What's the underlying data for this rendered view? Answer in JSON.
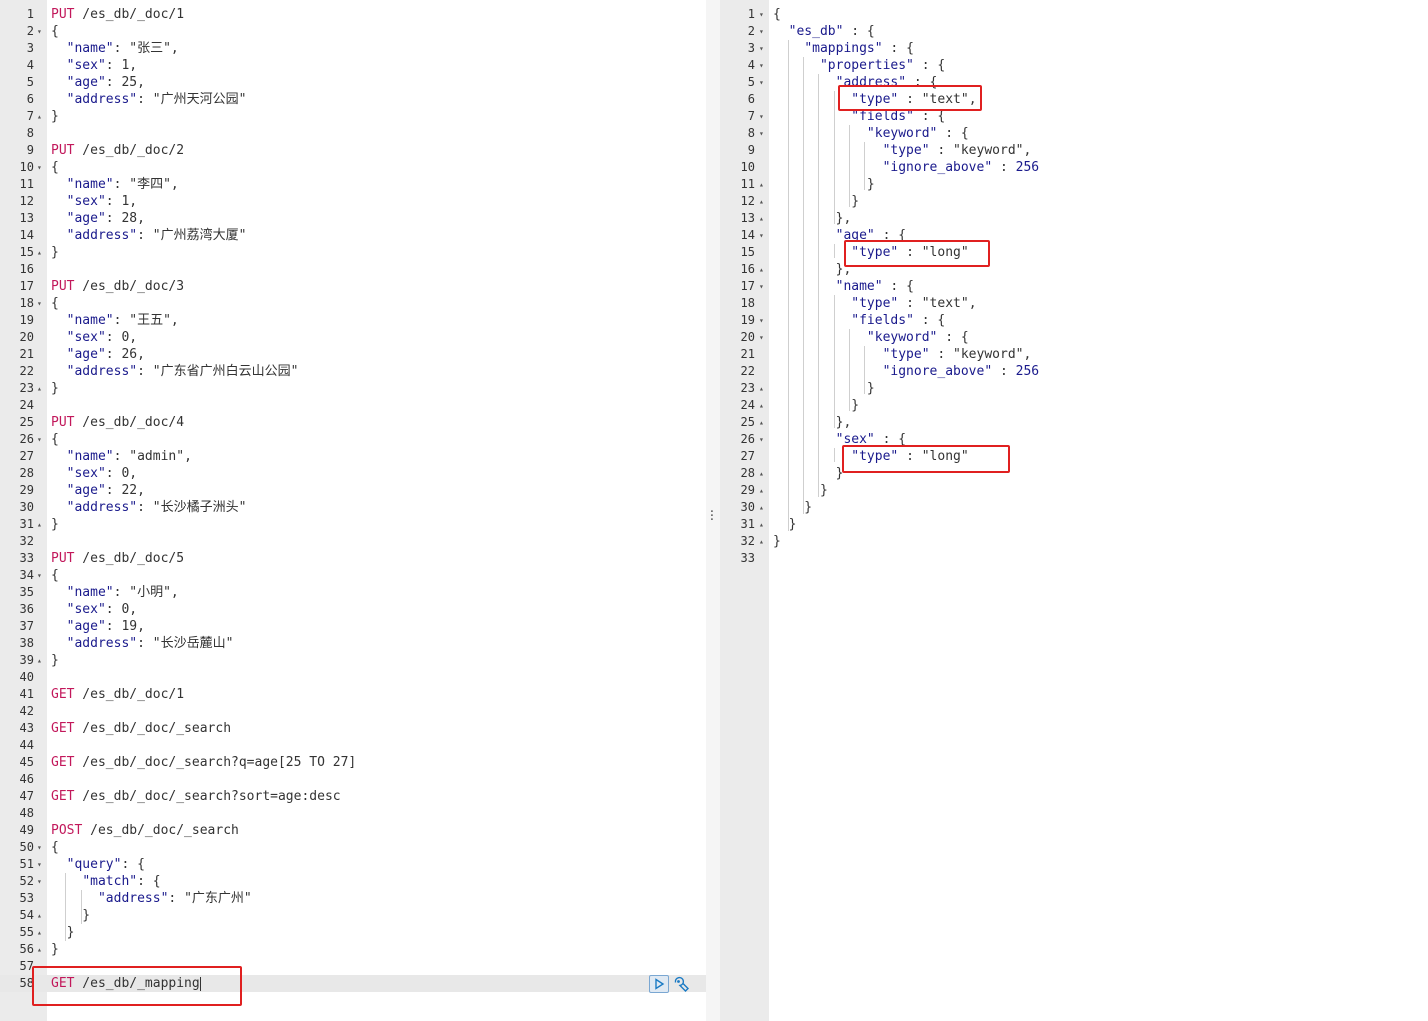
{
  "request_editor": {
    "lines": [
      {
        "n": "1",
        "fold": "",
        "parts": [
          [
            "m",
            "PUT"
          ],
          [
            "c",
            " /es_db/_doc/1"
          ]
        ]
      },
      {
        "n": "2",
        "fold": "▾",
        "parts": [
          [
            "c",
            "{"
          ]
        ]
      },
      {
        "n": "3",
        "fold": "",
        "parts": [
          [
            "c",
            "  "
          ],
          [
            "k",
            "\"name\""
          ],
          [
            "c",
            ": \"张三\","
          ]
        ]
      },
      {
        "n": "4",
        "fold": "",
        "parts": [
          [
            "c",
            "  "
          ],
          [
            "k",
            "\"sex\""
          ],
          [
            "c",
            ": 1,"
          ]
        ]
      },
      {
        "n": "5",
        "fold": "",
        "parts": [
          [
            "c",
            "  "
          ],
          [
            "k",
            "\"age\""
          ],
          [
            "c",
            ": 25,"
          ]
        ]
      },
      {
        "n": "6",
        "fold": "",
        "parts": [
          [
            "c",
            "  "
          ],
          [
            "k",
            "\"address\""
          ],
          [
            "c",
            ": \"广州天河公园\""
          ]
        ]
      },
      {
        "n": "7",
        "fold": "▴",
        "parts": [
          [
            "c",
            "}"
          ]
        ]
      },
      {
        "n": "8",
        "fold": "",
        "parts": []
      },
      {
        "n": "9",
        "fold": "",
        "parts": [
          [
            "m",
            "PUT"
          ],
          [
            "c",
            " /es_db/_doc/2"
          ]
        ]
      },
      {
        "n": "10",
        "fold": "▾",
        "parts": [
          [
            "c",
            "{"
          ]
        ]
      },
      {
        "n": "11",
        "fold": "",
        "parts": [
          [
            "c",
            "  "
          ],
          [
            "k",
            "\"name\""
          ],
          [
            "c",
            ": \"李四\","
          ]
        ]
      },
      {
        "n": "12",
        "fold": "",
        "parts": [
          [
            "c",
            "  "
          ],
          [
            "k",
            "\"sex\""
          ],
          [
            "c",
            ": 1,"
          ]
        ]
      },
      {
        "n": "13",
        "fold": "",
        "parts": [
          [
            "c",
            "  "
          ],
          [
            "k",
            "\"age\""
          ],
          [
            "c",
            ": 28,"
          ]
        ]
      },
      {
        "n": "14",
        "fold": "",
        "parts": [
          [
            "c",
            "  "
          ],
          [
            "k",
            "\"address\""
          ],
          [
            "c",
            ": \"广州荔湾大厦\""
          ]
        ]
      },
      {
        "n": "15",
        "fold": "▴",
        "parts": [
          [
            "c",
            "}"
          ]
        ]
      },
      {
        "n": "16",
        "fold": "",
        "parts": []
      },
      {
        "n": "17",
        "fold": "",
        "parts": [
          [
            "m",
            "PUT"
          ],
          [
            "c",
            " /es_db/_doc/3"
          ]
        ]
      },
      {
        "n": "18",
        "fold": "▾",
        "parts": [
          [
            "c",
            "{"
          ]
        ]
      },
      {
        "n": "19",
        "fold": "",
        "parts": [
          [
            "c",
            "  "
          ],
          [
            "k",
            "\"name\""
          ],
          [
            "c",
            ": \"王五\","
          ]
        ]
      },
      {
        "n": "20",
        "fold": "",
        "parts": [
          [
            "c",
            "  "
          ],
          [
            "k",
            "\"sex\""
          ],
          [
            "c",
            ": 0,"
          ]
        ]
      },
      {
        "n": "21",
        "fold": "",
        "parts": [
          [
            "c",
            "  "
          ],
          [
            "k",
            "\"age\""
          ],
          [
            "c",
            ": 26,"
          ]
        ]
      },
      {
        "n": "22",
        "fold": "",
        "parts": [
          [
            "c",
            "  "
          ],
          [
            "k",
            "\"address\""
          ],
          [
            "c",
            ": \"广东省广州白云山公园\""
          ]
        ]
      },
      {
        "n": "23",
        "fold": "▴",
        "parts": [
          [
            "c",
            "}"
          ]
        ]
      },
      {
        "n": "24",
        "fold": "",
        "parts": []
      },
      {
        "n": "25",
        "fold": "",
        "parts": [
          [
            "m",
            "PUT"
          ],
          [
            "c",
            " /es_db/_doc/4"
          ]
        ]
      },
      {
        "n": "26",
        "fold": "▾",
        "parts": [
          [
            "c",
            "{"
          ]
        ]
      },
      {
        "n": "27",
        "fold": "",
        "parts": [
          [
            "c",
            "  "
          ],
          [
            "k",
            "\"name\""
          ],
          [
            "c",
            ": \"admin\","
          ]
        ]
      },
      {
        "n": "28",
        "fold": "",
        "parts": [
          [
            "c",
            "  "
          ],
          [
            "k",
            "\"sex\""
          ],
          [
            "c",
            ": 0,"
          ]
        ]
      },
      {
        "n": "29",
        "fold": "",
        "parts": [
          [
            "c",
            "  "
          ],
          [
            "k",
            "\"age\""
          ],
          [
            "c",
            ": 22,"
          ]
        ]
      },
      {
        "n": "30",
        "fold": "",
        "parts": [
          [
            "c",
            "  "
          ],
          [
            "k",
            "\"address\""
          ],
          [
            "c",
            ": \"长沙橘子洲头\""
          ]
        ]
      },
      {
        "n": "31",
        "fold": "▴",
        "parts": [
          [
            "c",
            "}"
          ]
        ]
      },
      {
        "n": "32",
        "fold": "",
        "parts": []
      },
      {
        "n": "33",
        "fold": "",
        "parts": [
          [
            "m",
            "PUT"
          ],
          [
            "c",
            " /es_db/_doc/5"
          ]
        ]
      },
      {
        "n": "34",
        "fold": "▾",
        "parts": [
          [
            "c",
            "{"
          ]
        ]
      },
      {
        "n": "35",
        "fold": "",
        "parts": [
          [
            "c",
            "  "
          ],
          [
            "k",
            "\"name\""
          ],
          [
            "c",
            ": \"小明\","
          ]
        ]
      },
      {
        "n": "36",
        "fold": "",
        "parts": [
          [
            "c",
            "  "
          ],
          [
            "k",
            "\"sex\""
          ],
          [
            "c",
            ": 0,"
          ]
        ]
      },
      {
        "n": "37",
        "fold": "",
        "parts": [
          [
            "c",
            "  "
          ],
          [
            "k",
            "\"age\""
          ],
          [
            "c",
            ": 19,"
          ]
        ]
      },
      {
        "n": "38",
        "fold": "",
        "parts": [
          [
            "c",
            "  "
          ],
          [
            "k",
            "\"address\""
          ],
          [
            "c",
            ": \"长沙岳麓山\""
          ]
        ]
      },
      {
        "n": "39",
        "fold": "▴",
        "parts": [
          [
            "c",
            "}"
          ]
        ]
      },
      {
        "n": "40",
        "fold": "",
        "parts": []
      },
      {
        "n": "41",
        "fold": "",
        "parts": [
          [
            "m",
            "GET"
          ],
          [
            "c",
            " /es_db/_doc/1"
          ]
        ]
      },
      {
        "n": "42",
        "fold": "",
        "parts": []
      },
      {
        "n": "43",
        "fold": "",
        "parts": [
          [
            "m",
            "GET"
          ],
          [
            "c",
            " /es_db/_doc/_search"
          ]
        ]
      },
      {
        "n": "44",
        "fold": "",
        "parts": []
      },
      {
        "n": "45",
        "fold": "",
        "parts": [
          [
            "m",
            "GET"
          ],
          [
            "c",
            " /es_db/_doc/_search?q=age[25 TO 27]"
          ]
        ]
      },
      {
        "n": "46",
        "fold": "",
        "parts": []
      },
      {
        "n": "47",
        "fold": "",
        "parts": [
          [
            "m",
            "GET"
          ],
          [
            "c",
            " /es_db/_doc/_search?sort=age:desc"
          ]
        ]
      },
      {
        "n": "48",
        "fold": "",
        "parts": []
      },
      {
        "n": "49",
        "fold": "",
        "parts": [
          [
            "m",
            "POST"
          ],
          [
            "c",
            " /es_db/_doc/_search"
          ]
        ]
      },
      {
        "n": "50",
        "fold": "▾",
        "parts": [
          [
            "c",
            "{"
          ]
        ]
      },
      {
        "n": "51",
        "fold": "▾",
        "parts": [
          [
            "c",
            "  "
          ],
          [
            "k",
            "\"query\""
          ],
          [
            "c",
            ": {"
          ]
        ]
      },
      {
        "n": "52",
        "fold": "▾",
        "parts": [
          [
            "c",
            "    "
          ],
          [
            "k",
            "\"match\""
          ],
          [
            "c",
            ": {"
          ]
        ]
      },
      {
        "n": "53",
        "fold": "",
        "parts": [
          [
            "c",
            "      "
          ],
          [
            "k",
            "\"address\""
          ],
          [
            "c",
            ": \"广东广州\""
          ]
        ]
      },
      {
        "n": "54",
        "fold": "▴",
        "parts": [
          [
            "c",
            "    }"
          ]
        ]
      },
      {
        "n": "55",
        "fold": "▴",
        "parts": [
          [
            "c",
            "  }"
          ]
        ]
      },
      {
        "n": "56",
        "fold": "▴",
        "parts": [
          [
            "c",
            "}"
          ]
        ]
      },
      {
        "n": "57",
        "fold": "",
        "parts": []
      },
      {
        "n": "58",
        "fold": "",
        "parts": [
          [
            "m",
            "GET"
          ],
          [
            "c",
            " /es_db/_mapping"
          ]
        ],
        "active": true
      }
    ]
  },
  "response_viewer": {
    "lines": [
      {
        "n": "1",
        "fold": "▾",
        "parts": [
          [
            "c",
            "{"
          ]
        ]
      },
      {
        "n": "2",
        "fold": "▾",
        "parts": [
          [
            "c",
            "  "
          ],
          [
            "k",
            "\"es_db\""
          ],
          [
            "c",
            " : {"
          ]
        ]
      },
      {
        "n": "3",
        "fold": "▾",
        "parts": [
          [
            "c",
            "    "
          ],
          [
            "k",
            "\"mappings\""
          ],
          [
            "c",
            " : {"
          ]
        ]
      },
      {
        "n": "4",
        "fold": "▾",
        "parts": [
          [
            "c",
            "      "
          ],
          [
            "k",
            "\"properties\""
          ],
          [
            "c",
            " : {"
          ]
        ]
      },
      {
        "n": "5",
        "fold": "▾",
        "parts": [
          [
            "c",
            "        "
          ],
          [
            "k",
            "\"address\""
          ],
          [
            "c",
            " : {"
          ]
        ]
      },
      {
        "n": "6",
        "fold": "",
        "parts": [
          [
            "c",
            "          "
          ],
          [
            "k",
            "\"type\""
          ],
          [
            "c",
            " : \"text\","
          ]
        ]
      },
      {
        "n": "7",
        "fold": "▾",
        "parts": [
          [
            "c",
            "          "
          ],
          [
            "k",
            "\"fields\""
          ],
          [
            "c",
            " : {"
          ]
        ]
      },
      {
        "n": "8",
        "fold": "▾",
        "parts": [
          [
            "c",
            "            "
          ],
          [
            "k",
            "\"keyword\""
          ],
          [
            "c",
            " : {"
          ]
        ]
      },
      {
        "n": "9",
        "fold": "",
        "parts": [
          [
            "c",
            "              "
          ],
          [
            "k",
            "\"type\""
          ],
          [
            "c",
            " : \"keyword\","
          ]
        ]
      },
      {
        "n": "10",
        "fold": "",
        "parts": [
          [
            "c",
            "              "
          ],
          [
            "k",
            "\"ignore_above\""
          ],
          [
            "c",
            " : "
          ],
          [
            "n",
            "256"
          ]
        ]
      },
      {
        "n": "11",
        "fold": "▴",
        "parts": [
          [
            "c",
            "            }"
          ]
        ]
      },
      {
        "n": "12",
        "fold": "▴",
        "parts": [
          [
            "c",
            "          }"
          ]
        ]
      },
      {
        "n": "13",
        "fold": "▴",
        "parts": [
          [
            "c",
            "        },"
          ]
        ]
      },
      {
        "n": "14",
        "fold": "▾",
        "parts": [
          [
            "c",
            "        "
          ],
          [
            "k",
            "\"age\""
          ],
          [
            "c",
            " : {"
          ]
        ]
      },
      {
        "n": "15",
        "fold": "",
        "parts": [
          [
            "c",
            "          "
          ],
          [
            "k",
            "\"type\""
          ],
          [
            "c",
            " : \"long\""
          ]
        ]
      },
      {
        "n": "16",
        "fold": "▴",
        "parts": [
          [
            "c",
            "        },"
          ]
        ]
      },
      {
        "n": "17",
        "fold": "▾",
        "parts": [
          [
            "c",
            "        "
          ],
          [
            "k",
            "\"name\""
          ],
          [
            "c",
            " : {"
          ]
        ]
      },
      {
        "n": "18",
        "fold": "",
        "parts": [
          [
            "c",
            "          "
          ],
          [
            "k",
            "\"type\""
          ],
          [
            "c",
            " : \"text\","
          ]
        ]
      },
      {
        "n": "19",
        "fold": "▾",
        "parts": [
          [
            "c",
            "          "
          ],
          [
            "k",
            "\"fields\""
          ],
          [
            "c",
            " : {"
          ]
        ]
      },
      {
        "n": "20",
        "fold": "▾",
        "parts": [
          [
            "c",
            "            "
          ],
          [
            "k",
            "\"keyword\""
          ],
          [
            "c",
            " : {"
          ]
        ]
      },
      {
        "n": "21",
        "fold": "",
        "parts": [
          [
            "c",
            "              "
          ],
          [
            "k",
            "\"type\""
          ],
          [
            "c",
            " : \"keyword\","
          ]
        ]
      },
      {
        "n": "22",
        "fold": "",
        "parts": [
          [
            "c",
            "              "
          ],
          [
            "k",
            "\"ignore_above\""
          ],
          [
            "c",
            " : "
          ],
          [
            "n",
            "256"
          ]
        ]
      },
      {
        "n": "23",
        "fold": "▴",
        "parts": [
          [
            "c",
            "            }"
          ]
        ]
      },
      {
        "n": "24",
        "fold": "▴",
        "parts": [
          [
            "c",
            "          }"
          ]
        ]
      },
      {
        "n": "25",
        "fold": "▴",
        "parts": [
          [
            "c",
            "        },"
          ]
        ]
      },
      {
        "n": "26",
        "fold": "▾",
        "parts": [
          [
            "c",
            "        "
          ],
          [
            "k",
            "\"sex\""
          ],
          [
            "c",
            " : {"
          ]
        ]
      },
      {
        "n": "27",
        "fold": "",
        "parts": [
          [
            "c",
            "          "
          ],
          [
            "k",
            "\"type\""
          ],
          [
            "c",
            " : \"long\""
          ]
        ]
      },
      {
        "n": "28",
        "fold": "▴",
        "parts": [
          [
            "c",
            "        }"
          ]
        ]
      },
      {
        "n": "29",
        "fold": "▴",
        "parts": [
          [
            "c",
            "      }"
          ]
        ]
      },
      {
        "n": "30",
        "fold": "▴",
        "parts": [
          [
            "c",
            "    }"
          ]
        ]
      },
      {
        "n": "31",
        "fold": "▴",
        "parts": [
          [
            "c",
            "  }"
          ]
        ]
      },
      {
        "n": "32",
        "fold": "▴",
        "parts": [
          [
            "c",
            "}"
          ]
        ]
      },
      {
        "n": "33",
        "fold": "",
        "parts": []
      }
    ]
  },
  "icons": {
    "run": "play-icon",
    "settings": "wrench-icon",
    "divider": "vertical-ellipsis-icon"
  },
  "colors": {
    "method": "#c2185b",
    "key": "#1a1a8c",
    "highlight_box": "#e02020",
    "gutter": "#ebebeb"
  }
}
